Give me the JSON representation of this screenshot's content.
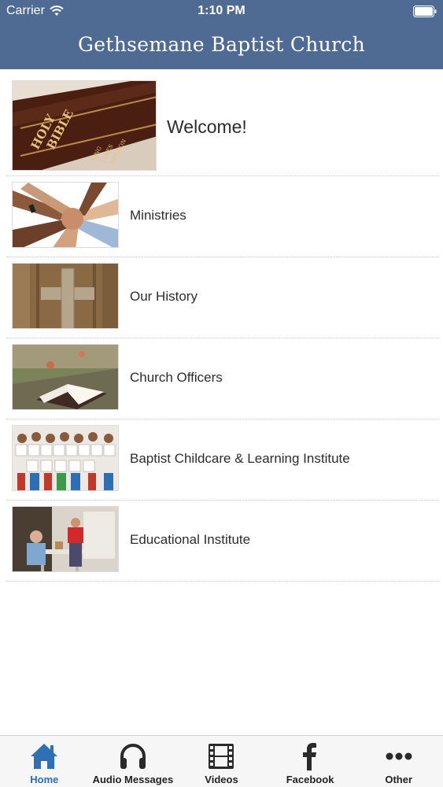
{
  "status_bar": {
    "carrier": "Carrier",
    "time": "1:10 PM"
  },
  "nav": {
    "title": "Gethsemane Baptist Church"
  },
  "list": {
    "items": [
      {
        "label": "Welcome!",
        "thumb_icon": "holy-bible-image"
      },
      {
        "label": "Ministries",
        "thumb_icon": "stacked-hands-image"
      },
      {
        "label": "Our History",
        "thumb_icon": "cross-image"
      },
      {
        "label": "Church Officers",
        "thumb_icon": "open-bible-image"
      },
      {
        "label": "Baptist Childcare & Learning Institute",
        "thumb_icon": "children-thank-you-image"
      },
      {
        "label": "Educational Institute",
        "thumb_icon": "classroom-image"
      }
    ]
  },
  "tabbar": {
    "tabs": [
      {
        "label": "Home",
        "icon": "home-icon",
        "active": true
      },
      {
        "label": "Audio Messages",
        "icon": "headphones-icon",
        "active": false
      },
      {
        "label": "Videos",
        "icon": "film-icon",
        "active": false
      },
      {
        "label": "Facebook",
        "icon": "facebook-icon",
        "active": false
      },
      {
        "label": "Other",
        "icon": "more-icon",
        "active": false
      }
    ]
  },
  "colors": {
    "nav_bar": "#4f6b94",
    "tab_active": "#2f6fb3"
  }
}
